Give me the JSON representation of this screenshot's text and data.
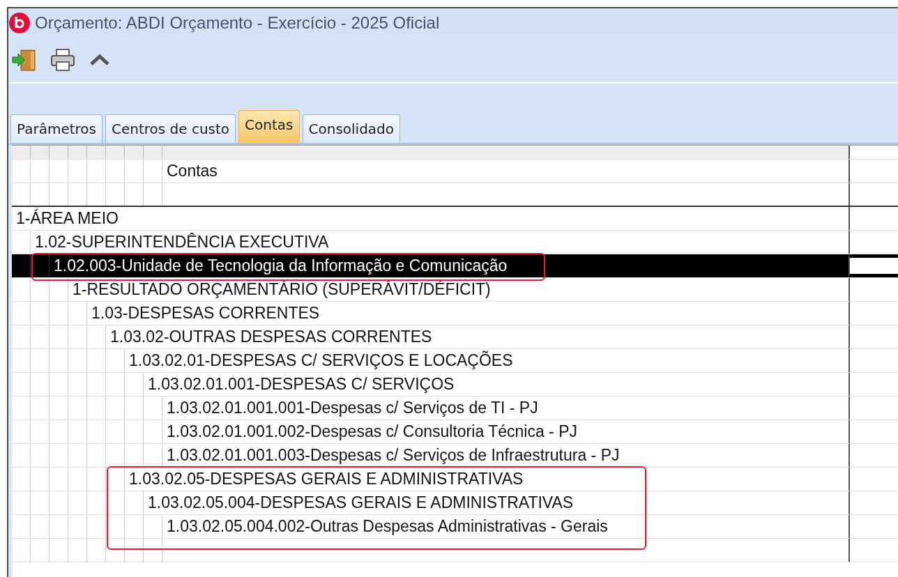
{
  "window": {
    "title": "Orçamento: ABDI Orçamento - Exercício - 2025 Oficial"
  },
  "tabs": [
    {
      "label": "Parâmetros",
      "selected": false
    },
    {
      "label": "Centros de custo",
      "selected": false
    },
    {
      "label": "Contas",
      "selected": true
    },
    {
      "label": "Consolidado",
      "selected": false
    }
  ],
  "grid": {
    "header": "Contas"
  },
  "accounts": [
    {
      "label": "1-ÁREA MEIO",
      "selected": false,
      "marked": false,
      "children": [
        {
          "label": "1.02-SUPERINTENDÊNCIA EXECUTIVA",
          "selected": false,
          "marked": false,
          "children": [
            {
              "label": "1.02.003-Unidade de Tecnologia da Informação e Comunicação",
              "selected": true,
              "marked": true,
              "children": [
                {
                  "label": "1-RESULTADO ORÇAMENTÁRIO (SUPERÁVIT/DÉFICIT)",
                  "selected": false,
                  "marked": false,
                  "children": [
                    {
                      "label": "1.03-DESPESAS CORRENTES",
                      "selected": false,
                      "marked": false,
                      "children": [
                        {
                          "label": "1.03.02-OUTRAS DESPESAS CORRENTES",
                          "selected": false,
                          "marked": false,
                          "children": [
                            {
                              "label": "1.03.02.01-DESPESAS C/ SERVIÇOS E LOCAÇÕES",
                              "selected": false,
                              "marked": false,
                              "children": [
                                {
                                  "label": "1.03.02.01.001-DESPESAS C/ SERVIÇOS",
                                  "selected": false,
                                  "marked": false,
                                  "children": [
                                    {
                                      "label": "1.03.02.01.001.001-Despesas c/ Serviços de TI - PJ",
                                      "selected": false,
                                      "marked": false
                                    },
                                    {
                                      "label": "1.03.02.01.001.002-Despesas c/ Consultoria Técnica - PJ",
                                      "selected": false,
                                      "marked": false
                                    },
                                    {
                                      "label": "1.03.02.01.001.003-Despesas c/ Serviços de Infraestrutura - PJ",
                                      "selected": false,
                                      "marked": false
                                    }
                                  ]
                                }
                              ]
                            },
                            {
                              "label": "1.03.02.05-DESPESAS GERAIS E ADMINISTRATIVAS",
                              "selected": false,
                              "marked": true,
                              "children": [
                                {
                                  "label": "1.03.02.05.004-DESPESAS GERAIS E ADMINISTRATIVAS",
                                  "selected": false,
                                  "marked": true,
                                  "children": [
                                    {
                                      "label": "1.03.02.05.004.002-Outras Despesas Administrativas - Gerais",
                                      "selected": false,
                                      "marked": true
                                    }
                                  ]
                                }
                              ]
                            }
                          ]
                        }
                      ]
                    }
                  ]
                }
              ]
            }
          ]
        }
      ]
    }
  ]
}
